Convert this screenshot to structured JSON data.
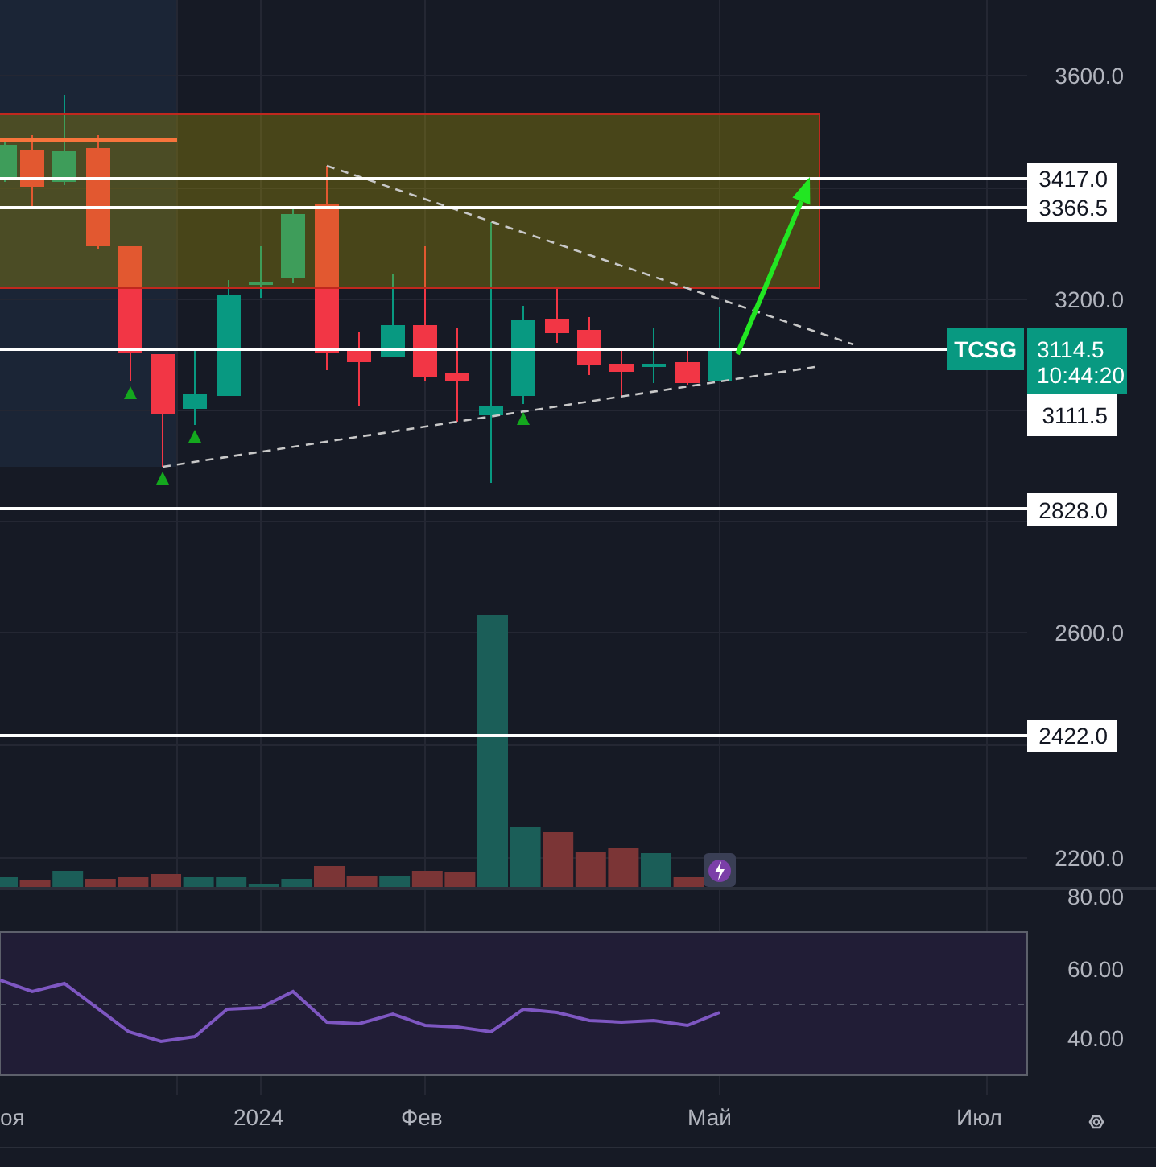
{
  "price_axis": {
    "ticks": [
      "3600.0",
      "3200.0",
      "2600.0",
      "2200.0"
    ]
  },
  "level_labels": [
    "3417.0",
    "3366.5",
    "3111.5",
    "2828.0",
    "2422.0"
  ],
  "last_price": {
    "symbol": "TCSG",
    "price": "3114.5",
    "countdown": "10:44:20"
  },
  "rsi_axis": {
    "ticks": [
      "80.00",
      "60.00",
      "40.00"
    ]
  },
  "time_axis": {
    "labels": [
      "оя",
      "2024",
      "Фев",
      "Май",
      "Июл"
    ]
  }
}
